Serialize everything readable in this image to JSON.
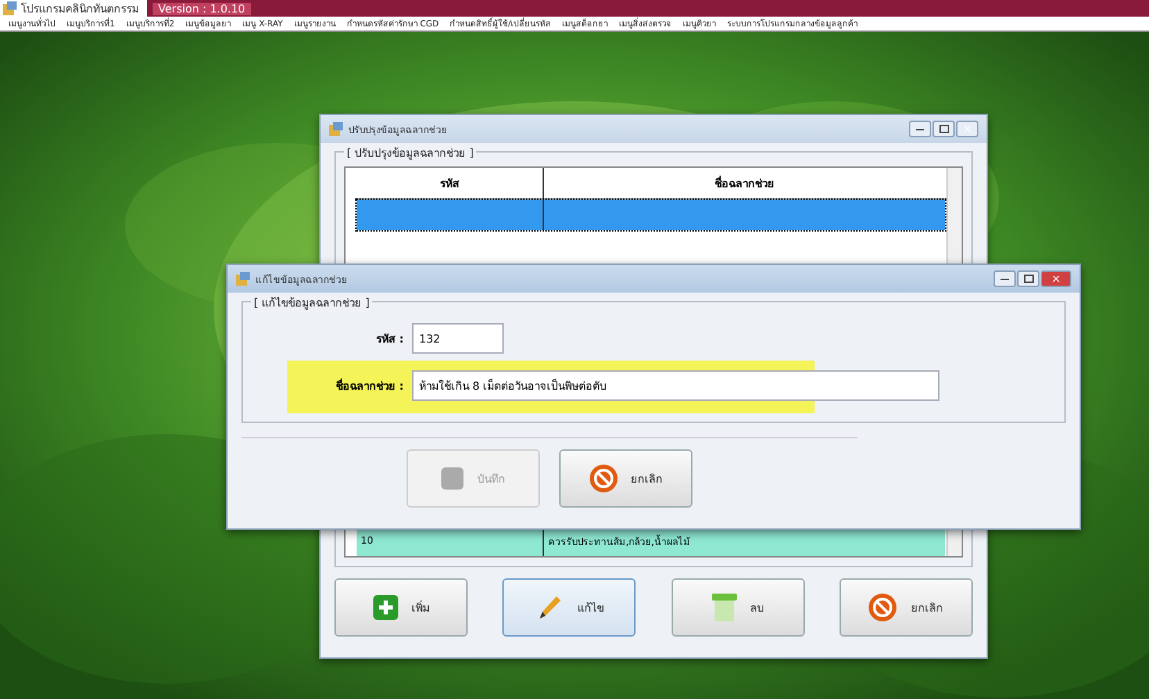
{
  "app": {
    "title": "โปรแกรมคลินิกทันตกรรม",
    "version": "Version : 1.0.10"
  },
  "menu": [
    "เมนูงานทั่วไป",
    "เมนูบริการที่1",
    "เมนูบริการที่2",
    "เมนูข้อมูลยา",
    "เมนู X-RAY",
    "เมนูรายงาน",
    "กำหนดรหัสค่ารักษา CGD",
    "กำหนดสิทธิ์ผู้ใช้/เปลี่ยนรหัส",
    "เมนูสต็อกยา",
    "เมนูสิ่งส่งตรวจ",
    "เมนูคิวยา",
    "ระบบการโปรแกรมกลางข้อมูลลูกค้า"
  ],
  "list_window": {
    "title": "ปรับปรุงข้อมูลฉลากช่วย",
    "group": "[ ปรับปรุงข้อมูลฉลากช่วย ]",
    "columns": [
      "รหัส",
      "ชื่อฉลากช่วย"
    ],
    "rows": [
      {
        "code": "",
        "name": "",
        "selected": true,
        "color": "#3399ee"
      },
      {
        "code": "10",
        "name": "ควรรับประทานส้ม,กล้วย,น้ำผลไม้",
        "selected": false,
        "color": "#8ee8d2"
      }
    ],
    "buttons": [
      {
        "label": "เพิ่ม",
        "kind": "add"
      },
      {
        "label": "แก้ไข",
        "kind": "edit"
      },
      {
        "label": "ลบ",
        "kind": "delete"
      },
      {
        "label": "ยกเลิก",
        "kind": "cancel"
      }
    ]
  },
  "edit_dialog": {
    "title": "แก้ไขข้อมูลฉลากช่วย",
    "group": "[ แก้ไขข้อมูลฉลากช่วย ]",
    "fields": [
      {
        "label": "รหัส :",
        "value": "132",
        "highlighted": false
      },
      {
        "label": "ชื่อฉลากช่วย :",
        "value": "ห้ามใช้เกิน 8 เม็ดต่อวันอาจเป็นพิษต่อตับ",
        "highlighted": true
      }
    ],
    "buttons": [
      {
        "label": "บันทึก",
        "kind": "save",
        "disabled": true
      },
      {
        "label": "ยกเลิก",
        "kind": "cancel",
        "disabled": false
      }
    ]
  }
}
